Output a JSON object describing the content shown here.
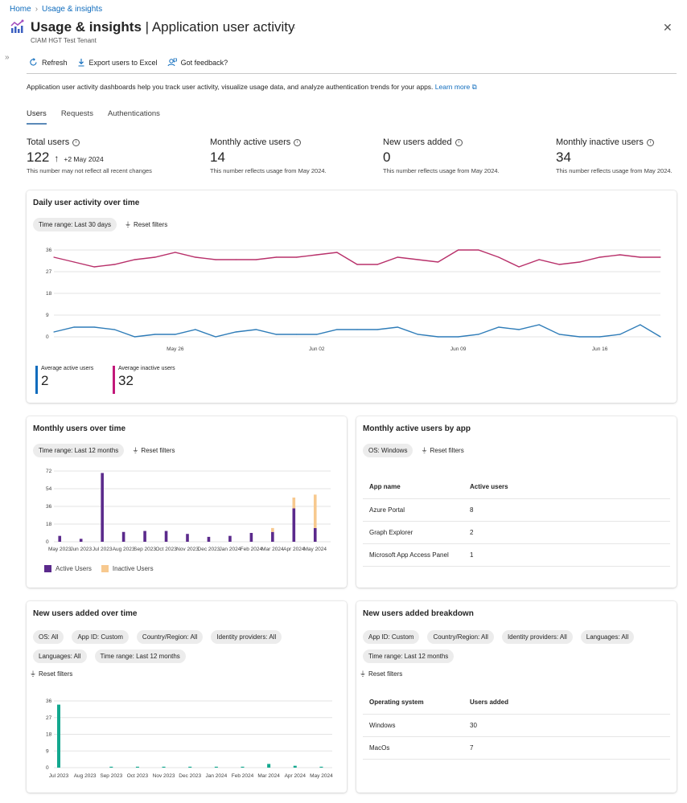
{
  "breadcrumb": [
    "Home",
    "Usage & insights"
  ],
  "header": {
    "title_bold": "Usage & insights",
    "title_rest": " | Application user activity",
    "subtitle": "CIAM HGT Test Tenant",
    "more": "···",
    "close": "✕",
    "collapse": "»"
  },
  "toolbar": {
    "refresh": "Refresh",
    "export": "Export users to Excel",
    "feedback": "Got feedback?"
  },
  "description": {
    "text": "Application user activity dashboards help you track user activity, visualize usage data, and analyze authentication trends for your apps.",
    "link": "Learn more"
  },
  "tabs": [
    {
      "label": "Users",
      "active": true
    },
    {
      "label": "Requests",
      "active": false
    },
    {
      "label": "Authentications",
      "active": false
    }
  ],
  "kpis": [
    {
      "label": "Total users",
      "value": "122",
      "delta": "+2 May 2024",
      "note": "This number may not reflect all recent changes"
    },
    {
      "label": "Monthly active users",
      "value": "14",
      "note": "This number reflects usage from May 2024."
    },
    {
      "label": "New users added",
      "value": "0",
      "note": "This number reflects usage from May 2024."
    },
    {
      "label": "Monthly inactive users",
      "value": "34",
      "note": "This number reflects usage from May 2024."
    }
  ],
  "colors": {
    "active": "#2e7cb8",
    "inactive": "#b8306a",
    "active_bar": "#5b2a8c",
    "inactive_bar": "#f7c98f",
    "new_users_bar": "#13a88f",
    "avg_active": "#0f6cbd",
    "avg_inactive": "#c2187a"
  },
  "daily": {
    "title": "Daily user activity over time",
    "filter": "Time range: Last 30 days",
    "reset": "Reset filters",
    "avg_active_label": "Average active users",
    "avg_active_value": "2",
    "avg_inactive_label": "Average inactive users",
    "avg_inactive_value": "32"
  },
  "monthly": {
    "title": "Monthly users over time",
    "filter": "Time range: Last 12 months",
    "reset": "Reset filters",
    "legend_active": "Active Users",
    "legend_inactive": "Inactive Users"
  },
  "by_app": {
    "title": "Monthly active users by app",
    "filter": "OS: Windows",
    "reset": "Reset filters",
    "columns": [
      "App name",
      "Active users"
    ],
    "rows": [
      [
        "Azure Portal",
        "8"
      ],
      [
        "Graph Explorer",
        "2"
      ],
      [
        "Microsoft App Access Panel",
        "1"
      ]
    ]
  },
  "new_users": {
    "title": "New users added over time",
    "filters": [
      "OS: All",
      "App ID: Custom",
      "Country/Region: All",
      "Identity providers: All",
      "Languages: All",
      "Time range: Last 12 months"
    ],
    "reset": "Reset filters"
  },
  "breakdown": {
    "title": "New users added breakdown",
    "filters": [
      "App ID: Custom",
      "Country/Region: All",
      "Identity providers: All",
      "Languages: All",
      "Time range: Last 12 months"
    ],
    "reset": "Reset filters",
    "columns": [
      "Operating system",
      "Users added"
    ],
    "rows": [
      [
        "Windows",
        "30"
      ],
      [
        "MacOs",
        "7"
      ]
    ]
  },
  "chart_data": [
    {
      "type": "line",
      "title": "Daily user activity over time",
      "x": [
        "May 20",
        "May 21",
        "May 22",
        "May 23",
        "May 24",
        "May 25",
        "May 26",
        "May 27",
        "May 28",
        "May 29",
        "May 30",
        "May 31",
        "Jun 01",
        "Jun 02",
        "Jun 03",
        "Jun 04",
        "Jun 05",
        "Jun 06",
        "Jun 07",
        "Jun 08",
        "Jun 09",
        "Jun 10",
        "Jun 11",
        "Jun 12",
        "Jun 13",
        "Jun 14",
        "Jun 15",
        "Jun 16",
        "Jun 17",
        "Jun 18",
        "Jun 19"
      ],
      "x_tick_labels": [
        {
          "index": 6,
          "label": "May 26"
        },
        {
          "index": 13,
          "label": "Jun 02"
        },
        {
          "index": 20,
          "label": "Jun 09"
        },
        {
          "index": 27,
          "label": "Jun 16"
        }
      ],
      "series": [
        {
          "name": "Inactive users",
          "values": [
            33,
            31,
            29,
            30,
            32,
            33,
            35,
            33,
            32,
            32,
            32,
            33,
            33,
            34,
            35,
            30,
            30,
            33,
            32,
            31,
            36,
            36,
            33,
            29,
            32,
            30,
            31,
            33,
            34,
            33,
            33
          ]
        },
        {
          "name": "Active users",
          "values": [
            2,
            4,
            4,
            3,
            0,
            1,
            1,
            3,
            0,
            2,
            3,
            1,
            1,
            1,
            3,
            3,
            3,
            4,
            1,
            0,
            0,
            1,
            4,
            3,
            5,
            1,
            0,
            0,
            1,
            5,
            0
          ]
        }
      ],
      "y_ticks": [
        0,
        9,
        18,
        27,
        36
      ],
      "ylim": [
        0,
        36
      ],
      "grid": true,
      "xlabel": "",
      "ylabel": ""
    },
    {
      "type": "bar",
      "stacked": true,
      "title": "Monthly users over time",
      "categories": [
        "May 2023",
        "Jun 2023",
        "Jul 2023",
        "Aug 2023",
        "Sep 2023",
        "Oct 2023",
        "Nov 2023",
        "Dec 2023",
        "Jan 2024",
        "Feb 2024",
        "Mar 2024",
        "Apr 2024",
        "May 2024"
      ],
      "series": [
        {
          "name": "Active Users",
          "values": [
            6,
            3,
            70,
            10,
            11,
            11,
            8,
            5,
            6,
            9,
            10,
            34,
            14
          ]
        },
        {
          "name": "Inactive Users",
          "values": [
            0,
            0,
            0,
            0,
            0,
            0,
            0,
            0,
            0,
            0,
            4,
            11,
            34
          ]
        }
      ],
      "y_ticks": [
        0,
        18,
        36,
        54,
        72
      ],
      "ylim": [
        0,
        72
      ],
      "legend": "bottom-left",
      "grid": true
    },
    {
      "type": "bar",
      "title": "New users added over time",
      "categories": [
        "Jul 2023",
        "Aug 2023",
        "Sep 2023",
        "Oct 2023",
        "Nov 2023",
        "Dec 2023",
        "Jan 2024",
        "Feb 2024",
        "Mar 2024",
        "Apr 2024",
        "May 2024"
      ],
      "values": [
        34,
        0,
        0.5,
        0.5,
        0.5,
        0.5,
        0.5,
        0.5,
        2,
        1,
        0.5
      ],
      "y_ticks": [
        0,
        9,
        18,
        27,
        36
      ],
      "ylim": [
        0,
        36
      ],
      "grid": true
    }
  ]
}
